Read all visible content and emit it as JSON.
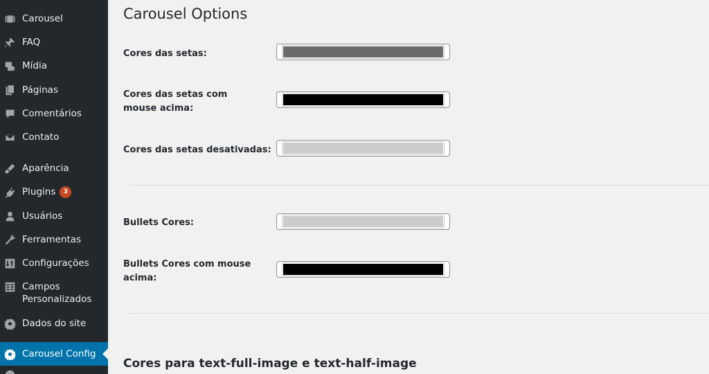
{
  "sidebar": {
    "items": [
      {
        "label": "Carousel",
        "icon": "carousel-icon"
      },
      {
        "label": "FAQ",
        "icon": "pin-icon"
      },
      {
        "label": "Mídia",
        "icon": "media-icon"
      },
      {
        "label": "Páginas",
        "icon": "pages-icon"
      },
      {
        "label": "Comentários",
        "icon": "comments-icon"
      },
      {
        "label": "Contato",
        "icon": "mail-icon"
      },
      {
        "label": "Aparência",
        "icon": "brush-icon"
      },
      {
        "label": "Plugins",
        "icon": "plugin-icon",
        "badge": "3"
      },
      {
        "label": "Usuários",
        "icon": "user-icon"
      },
      {
        "label": "Ferramentas",
        "icon": "wrench-icon"
      },
      {
        "label": "Configurações",
        "icon": "settings-icon"
      },
      {
        "label": "Campos Personalizados",
        "line1": "Campos",
        "line2": "Personalizados",
        "icon": "fields-icon"
      },
      {
        "label": "Dados do site",
        "icon": "gear-icon"
      },
      {
        "label": "Carousel Config",
        "icon": "gear-icon",
        "active": true
      }
    ]
  },
  "main": {
    "title": "Carousel Options",
    "options": [
      {
        "label": "Cores das setas:",
        "color": "#6b6b6b"
      },
      {
        "label": "Cores das setas com mouse acima:",
        "color": "#000000"
      },
      {
        "label": "Cores das setas desativadas:",
        "color": "#cccccc"
      },
      {
        "label": "Bullets Cores:",
        "color": "#cccccc"
      },
      {
        "label": "Bullets Cores com mouse acima:",
        "color": "#000000"
      }
    ],
    "section_heading": "Cores para text-full-image e text-half-image"
  },
  "colors": {
    "sidebar_bg": "#23282d",
    "active": "#0073aa",
    "badge": "#ca4a1f",
    "page_bg": "#f1f1f1"
  }
}
